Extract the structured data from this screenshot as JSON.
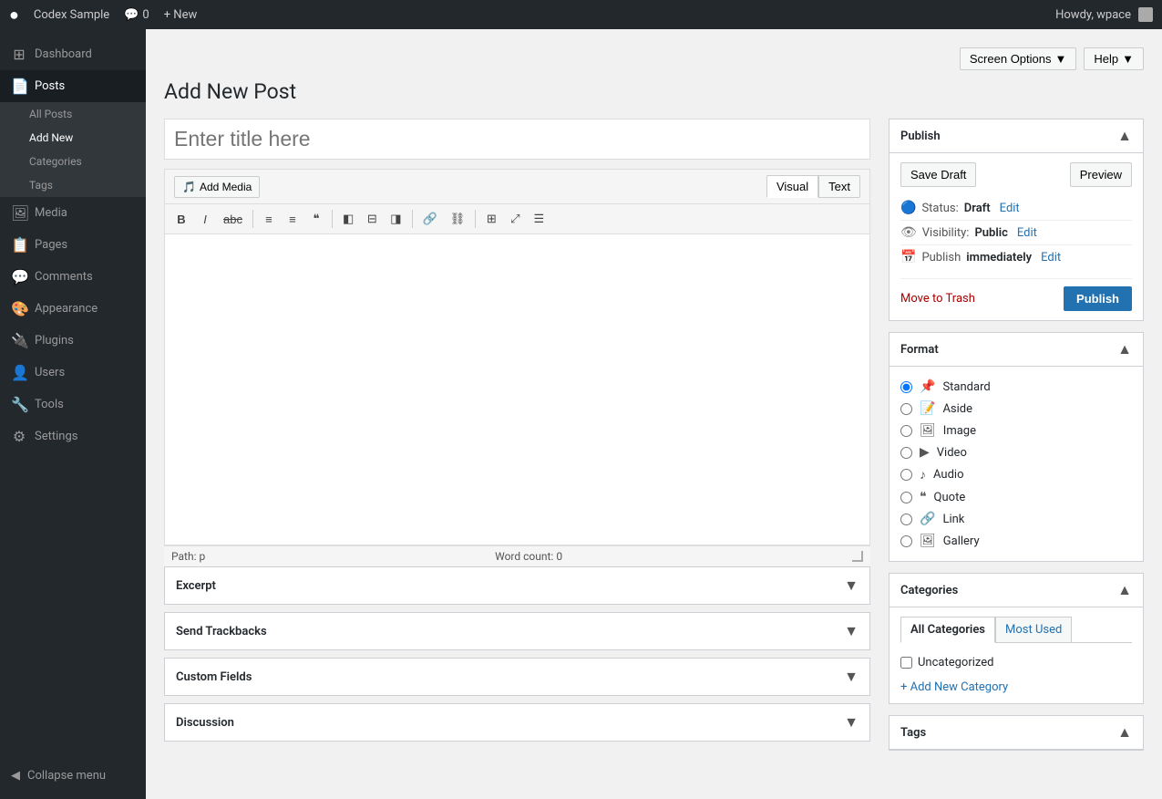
{
  "adminbar": {
    "logo": "W",
    "site_name": "Codex Sample",
    "comments_icon": "💬",
    "comments_count": "0",
    "new_label": "+ New",
    "howdy": "Howdy, wpace",
    "screen_options": "Screen Options",
    "help": "Help"
  },
  "sidebar": {
    "items": [
      {
        "id": "dashboard",
        "icon": "⊞",
        "label": "Dashboard"
      },
      {
        "id": "posts",
        "icon": "📄",
        "label": "Posts",
        "active": true
      },
      {
        "id": "media",
        "icon": "🖼",
        "label": "Media"
      },
      {
        "id": "pages",
        "icon": "📋",
        "label": "Pages"
      },
      {
        "id": "comments",
        "icon": "💬",
        "label": "Comments"
      },
      {
        "id": "appearance",
        "icon": "🎨",
        "label": "Appearance"
      },
      {
        "id": "plugins",
        "icon": "🔌",
        "label": "Plugins"
      },
      {
        "id": "users",
        "icon": "👤",
        "label": "Users"
      },
      {
        "id": "tools",
        "icon": "🔧",
        "label": "Tools"
      },
      {
        "id": "settings",
        "icon": "⚙",
        "label": "Settings"
      }
    ],
    "submenu": [
      {
        "id": "all-posts",
        "label": "All Posts"
      },
      {
        "id": "add-new",
        "label": "Add New",
        "active": true
      },
      {
        "id": "categories",
        "label": "Categories"
      },
      {
        "id": "tags",
        "label": "Tags"
      }
    ],
    "collapse_label": "Collapse menu"
  },
  "page": {
    "title": "Add New Post",
    "title_placeholder": "Enter title here"
  },
  "editor": {
    "add_media_label": "Add Media",
    "tab_visual": "Visual",
    "tab_text": "Text",
    "toolbar_buttons": [
      "B",
      "I",
      "ABC",
      "≡",
      "≡",
      "❝",
      "←",
      "→",
      "≡",
      "🔗",
      "🔗❌",
      "⊞",
      "↔",
      "⊟"
    ],
    "path_label": "Path:",
    "path_value": "p",
    "word_count_label": "Word count:",
    "word_count_value": "0"
  },
  "sections": [
    {
      "id": "excerpt",
      "label": "Excerpt"
    },
    {
      "id": "trackbacks",
      "label": "Send Trackbacks"
    },
    {
      "id": "custom-fields",
      "label": "Custom Fields"
    },
    {
      "id": "discussion",
      "label": "Discussion"
    }
  ],
  "publish_box": {
    "title": "Publish",
    "save_draft": "Save Draft",
    "preview": "Preview",
    "status_label": "Status:",
    "status_value": "Draft",
    "status_edit": "Edit",
    "visibility_label": "Visibility:",
    "visibility_value": "Public",
    "visibility_edit": "Edit",
    "publish_label": "Publish",
    "publish_time": "immediately",
    "publish_edit": "Edit",
    "move_trash": "Move to Trash",
    "publish_btn": "Publish"
  },
  "format_box": {
    "title": "Format",
    "formats": [
      {
        "id": "standard",
        "icon": "📌",
        "label": "Standard",
        "checked": true
      },
      {
        "id": "aside",
        "icon": "📝",
        "label": "Aside",
        "checked": false
      },
      {
        "id": "image",
        "icon": "🖼",
        "label": "Image",
        "checked": false
      },
      {
        "id": "video",
        "icon": "▶",
        "label": "Video",
        "checked": false
      },
      {
        "id": "audio",
        "icon": "♪",
        "label": "Audio",
        "checked": false
      },
      {
        "id": "quote",
        "icon": "❝",
        "label": "Quote",
        "checked": false
      },
      {
        "id": "link",
        "icon": "🔗",
        "label": "Link",
        "checked": false
      },
      {
        "id": "gallery",
        "icon": "🖼",
        "label": "Gallery",
        "checked": false
      }
    ]
  },
  "categories_box": {
    "title": "Categories",
    "tab_all": "All Categories",
    "tab_most_used": "Most Used",
    "items": [
      {
        "id": "uncategorized",
        "label": "Uncategorized",
        "checked": false
      }
    ],
    "add_new": "+ Add New Category"
  },
  "tags_box": {
    "title": "Tags"
  }
}
